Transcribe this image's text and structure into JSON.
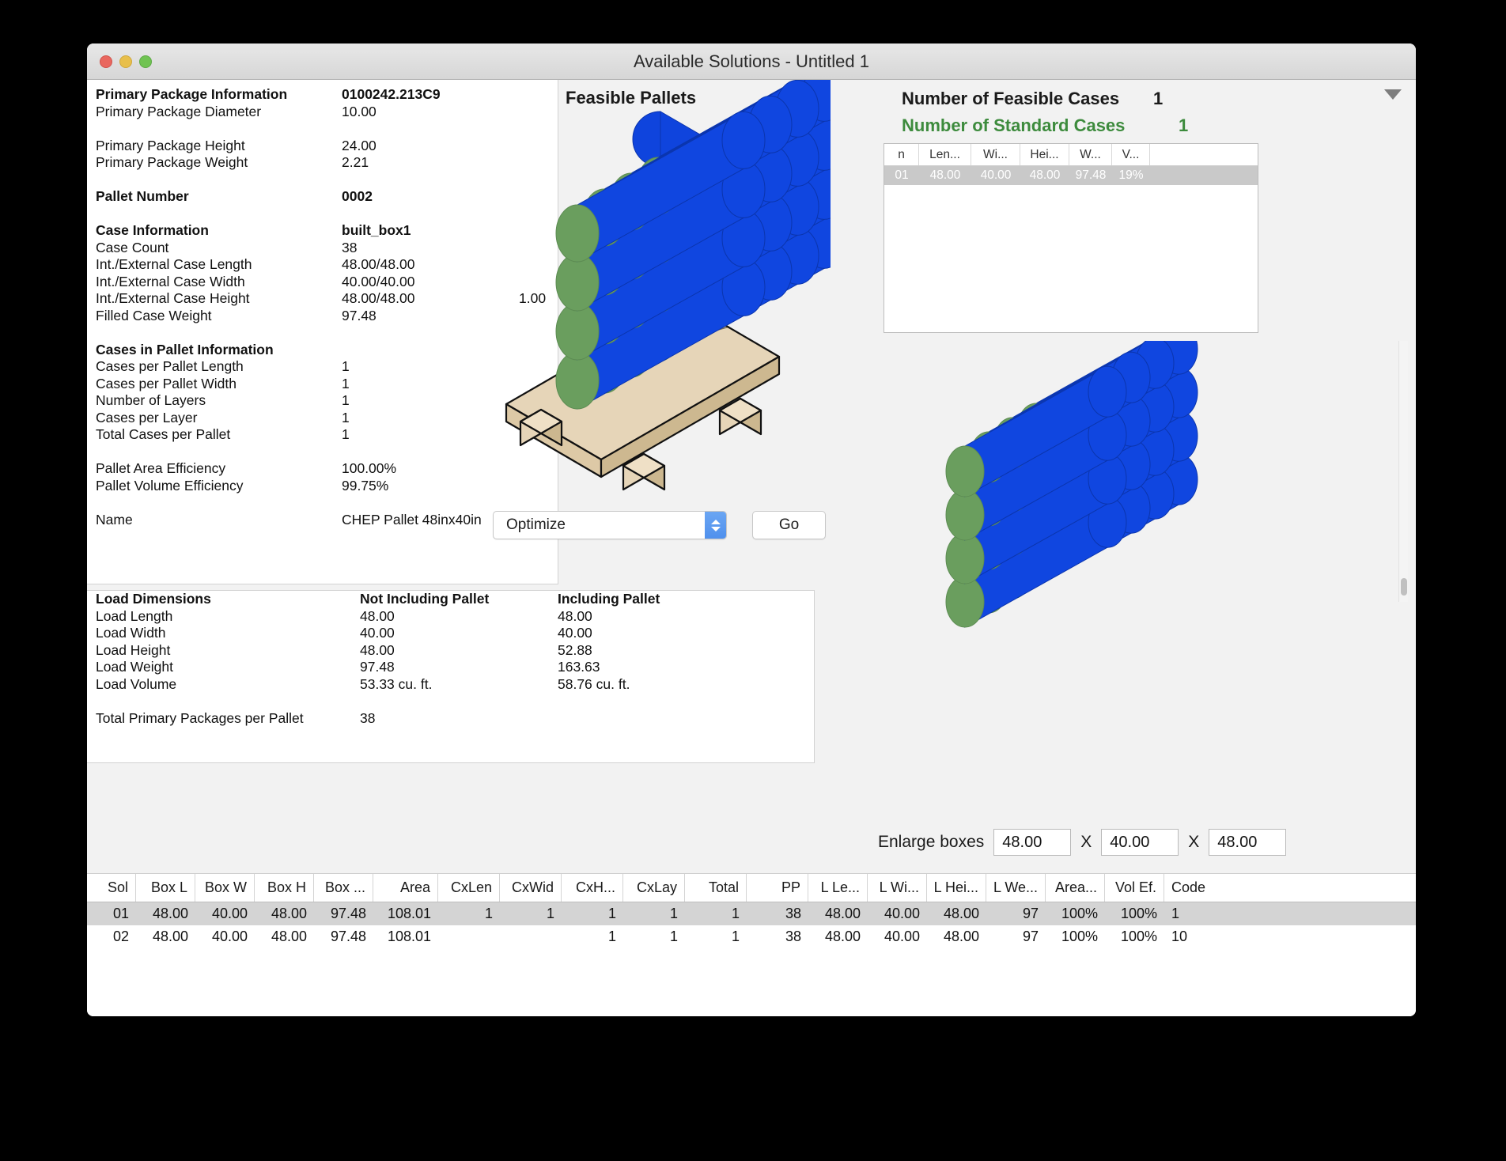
{
  "window": {
    "title": "Available Solutions - Untitled 1",
    "traffic_lights": [
      "close",
      "minimize",
      "maximize"
    ]
  },
  "left_panel": {
    "rows": [
      {
        "label": "Primary Package Information",
        "value": "0100242.213C9",
        "bold": true
      },
      {
        "label": "Primary Package Diameter",
        "value": "10.00",
        "bold": false
      },
      {
        "label": "",
        "value": "",
        "spacer": true
      },
      {
        "label": "Primary Package Height",
        "value": "24.00",
        "bold": false
      },
      {
        "label": "Primary Package Weight",
        "value": "2.21",
        "bold": false
      },
      {
        "label": "",
        "value": "",
        "spacer": true
      },
      {
        "label": "Pallet Number",
        "value": "0002",
        "bold": true
      },
      {
        "label": "",
        "value": "",
        "spacer": true
      },
      {
        "label": "Case Information",
        "value": "built_box1",
        "bold": true
      },
      {
        "label": "Case Count",
        "value": "38",
        "bold": false
      },
      {
        "label": "Int./External Case Length",
        "value": "48.00/48.00",
        "bold": false
      },
      {
        "label": "Int./External Case Width",
        "value": "40.00/40.00",
        "bold": false
      },
      {
        "label": "Int./External Case Height",
        "value": "48.00/48.00",
        "value2": "1.00",
        "bold": false
      },
      {
        "label": "Filled Case Weight",
        "value": "97.48",
        "bold": false
      },
      {
        "label": "",
        "value": "",
        "spacer": true
      },
      {
        "label": "Cases in Pallet Information",
        "value": "",
        "bold": true
      },
      {
        "label": "Cases per Pallet Length",
        "value": "1",
        "bold": false
      },
      {
        "label": "Cases per Pallet Width",
        "value": "1",
        "bold": false
      },
      {
        "label": "Number of Layers",
        "value": "1",
        "bold": false
      },
      {
        "label": "Cases per Layer",
        "value": "1",
        "bold": false
      },
      {
        "label": "Total Cases per Pallet",
        "value": "1",
        "bold": false
      },
      {
        "label": "",
        "value": "",
        "spacer": true
      },
      {
        "label": "Pallet Area Efficiency",
        "value": "100.00%",
        "bold": false
      },
      {
        "label": "Pallet Volume Efficiency",
        "value": "99.75%",
        "bold": false
      },
      {
        "label": "",
        "value": "",
        "spacer": true
      },
      {
        "label": "Name",
        "value": "CHEP Pallet 48inx40in",
        "bold": false
      }
    ]
  },
  "load_panel": {
    "rows": [
      {
        "c1": "Load Dimensions",
        "c2": "Not Including Pallet",
        "c3": "Including Pallet",
        "bold": true
      },
      {
        "c1": "Load Length",
        "c2": "48.00",
        "c3": "48.00",
        "bold": false
      },
      {
        "c1": "Load Width",
        "c2": "40.00",
        "c3": "40.00",
        "bold": false
      },
      {
        "c1": "Load Height",
        "c2": "48.00",
        "c3": "52.88",
        "bold": false
      },
      {
        "c1": "Load Weight",
        "c2": "97.48",
        "c3": "163.63",
        "bold": false
      },
      {
        "c1": "Load Volume",
        "c2": "53.33 cu. ft.",
        "c3": "58.76 cu. ft.",
        "bold": false
      },
      {
        "c1": "",
        "c2": "",
        "c3": "",
        "spacer": true
      },
      {
        "c1": "Total Primary Packages per Pallet",
        "c2": "38",
        "c3": "",
        "bold": false
      }
    ]
  },
  "middle": {
    "heading": "Feasible Pallets",
    "count": "2",
    "optimize_select_value": "Optimize",
    "go_button": "Go"
  },
  "right": {
    "feasible_cases_label": "Number of Feasible Cases",
    "feasible_cases_value": "1",
    "standard_cases_label": "Number of Standard Cases",
    "standard_cases_value": "1",
    "standard_cases_color": "#3d8b3d",
    "cases_table": {
      "headers": [
        "n",
        "Len...",
        "Wi...",
        "Hei...",
        "W...",
        "V...",
        ""
      ],
      "rows": [
        {
          "selected": true,
          "cells": [
            "01",
            "48.00",
            "40.00",
            "48.00",
            "97.48",
            "19%",
            ""
          ]
        }
      ]
    },
    "enlarge": {
      "label": "Enlarge boxes",
      "separator": "X",
      "length": "48.00",
      "width": "40.00",
      "height": "48.00"
    }
  },
  "solutions_table": {
    "headers": [
      "Sol",
      "Box L",
      "Box W",
      "Box H",
      "Box ...",
      "Area",
      "CxLen",
      "CxWid",
      "CxH...",
      "CxLay",
      "Total",
      "PP",
      "L Le...",
      "L Wi...",
      "L Hei...",
      "L We...",
      "Area...",
      "Vol Ef.",
      "Code"
    ],
    "rows": [
      {
        "selected": true,
        "cells": [
          "01",
          "48.00",
          "40.00",
          "48.00",
          "97.48",
          "108.01",
          "1",
          "1",
          "1",
          "1",
          "1",
          "38",
          "48.00",
          "40.00",
          "48.00",
          "97",
          "100%",
          "100%",
          "1"
        ]
      },
      {
        "selected": false,
        "cells": [
          "02",
          "48.00",
          "40.00",
          "48.00",
          "97.48",
          "108.01",
          "",
          "",
          "1",
          "1",
          "1",
          "38",
          "48.00",
          "40.00",
          "48.00",
          "97",
          "100%",
          "100%",
          "10"
        ]
      }
    ]
  },
  "colors": {
    "package_body": "#1046e0",
    "package_cap": "#6a9e5e",
    "pallet_wood": "#e6d5b8",
    "selection_gray": "#d4d4d4",
    "accent_green": "#3d8b3d",
    "stepper_blue": "#4f90ed"
  }
}
